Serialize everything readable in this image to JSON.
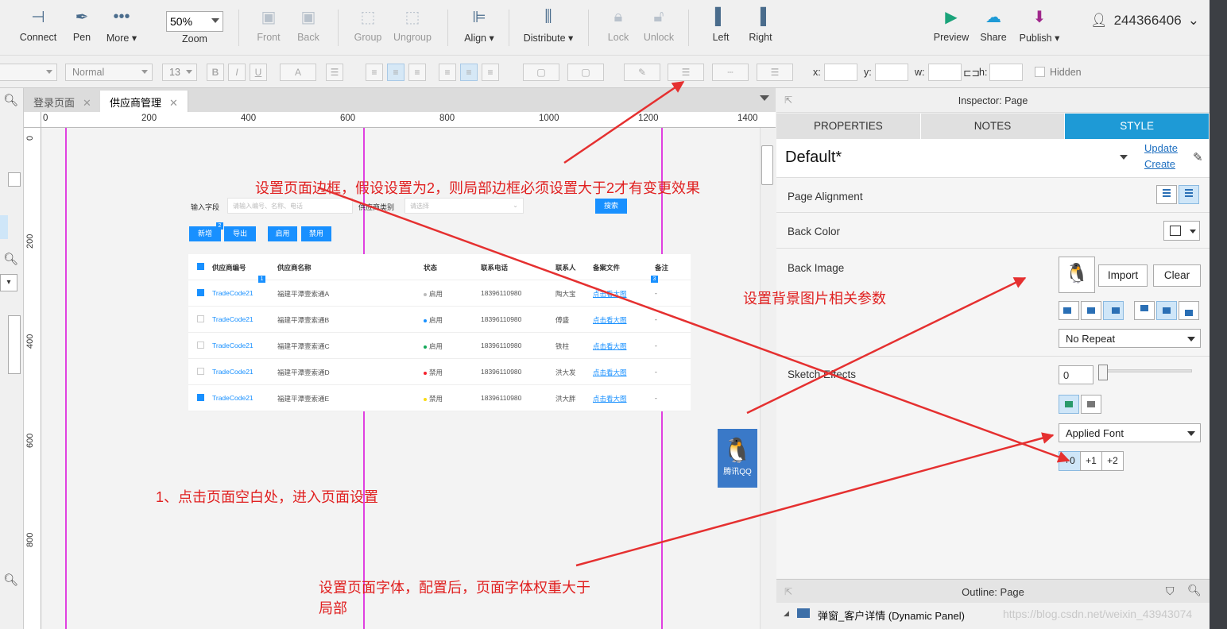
{
  "toolbar": {
    "items": [
      {
        "label": "Connect",
        "icon": "connect-icon"
      },
      {
        "label": "Pen",
        "icon": "pen-icon"
      },
      {
        "label": "More ▾",
        "icon": "more-icon"
      },
      {
        "label": "Zoom",
        "icon": "zoom"
      },
      {
        "label": "Front",
        "icon": "bring-front-icon"
      },
      {
        "label": "Back",
        "icon": "send-back-icon"
      },
      {
        "label": "Group",
        "icon": "group-icon"
      },
      {
        "label": "Ungroup",
        "icon": "ungroup-icon"
      },
      {
        "label": "Align ▾",
        "icon": "align-icon"
      },
      {
        "label": "Distribute ▾",
        "icon": "distribute-icon"
      },
      {
        "label": "Lock",
        "icon": "lock-icon"
      },
      {
        "label": "Unlock",
        "icon": "unlock-icon"
      },
      {
        "label": "Left",
        "icon": "left-panel-icon"
      },
      {
        "label": "Right",
        "icon": "right-panel-icon"
      },
      {
        "label": "Preview",
        "icon": "preview-icon"
      },
      {
        "label": "Share",
        "icon": "share-icon"
      },
      {
        "label": "Publish ▾",
        "icon": "publish-icon"
      }
    ],
    "zoom_value": "50%",
    "user": "244366406"
  },
  "format_bar": {
    "style_value": "Normal",
    "size_value": "13",
    "bold": "B",
    "italic": "I",
    "underline": "U",
    "font_color": "A",
    "x_label": "x:",
    "y_label": "y:",
    "w_label": "w:",
    "h_label": "h:",
    "hidden_label": "Hidden"
  },
  "tabs": [
    {
      "label": "登录页面",
      "active": false
    },
    {
      "label": "供应商管理",
      "active": true
    }
  ],
  "ruler": {
    "h": [
      "0",
      "200",
      "400",
      "600",
      "800",
      "1000",
      "1200",
      "1400"
    ],
    "v": [
      "0",
      "200",
      "400",
      "600",
      "800"
    ]
  },
  "proto": {
    "field1_label": "输入字段",
    "field1_placeholder": "请输入编号、名称、电话",
    "field2_label": "供应商类别",
    "field2_placeholder": "请选择",
    "search_btn": "搜索",
    "buttons": [
      "新增",
      "导出",
      "启用",
      "禁用"
    ],
    "badge_new": "2",
    "badge_1": "1",
    "badge_3": "3",
    "headers": [
      "供应商编号",
      "供应商名称",
      "状态",
      "联系电话",
      "联系人",
      "备案文件",
      "备注"
    ],
    "rows": [
      {
        "code": "TradeCode21",
        "name": "福建平潭壹索通A",
        "status": "启用",
        "status_color": "#bbbbbb",
        "phone": "18396110980",
        "contact": "陶大宝",
        "file": "点击看大图",
        "note": "-",
        "checked": true
      },
      {
        "code": "TradeCode21",
        "name": "福建平潭壹索通B",
        "status": "启用",
        "status_color": "#1890ff",
        "phone": "18396110980",
        "contact": "傅盛",
        "file": "点击看大图",
        "note": "-",
        "checked": false
      },
      {
        "code": "TradeCode21",
        "name": "福建平潭壹索通C",
        "status": "启用",
        "status_color": "#13a859",
        "phone": "18396110980",
        "contact": "铁柱",
        "file": "点击看大图",
        "note": "-",
        "checked": false
      },
      {
        "code": "TradeCode21",
        "name": "福建平潭壹索通D",
        "status": "禁用",
        "status_color": "#f5222d",
        "phone": "18396110980",
        "contact": "洪大发",
        "file": "点击看大图",
        "note": "-",
        "checked": false
      },
      {
        "code": "TradeCode21",
        "name": "福建平潭壹索通E",
        "status": "禁用",
        "status_color": "#fadb14",
        "phone": "18396110980",
        "contact": "洪大胖",
        "file": "点击看大图",
        "note": "-",
        "checked": true
      }
    ],
    "qq_label": "腾讯QQ"
  },
  "inspector": {
    "title": "Inspector: Page",
    "tabs": [
      {
        "label": "PROPERTIES"
      },
      {
        "label": "NOTES"
      },
      {
        "label": "STYLE",
        "active": true
      }
    ],
    "style_name": "Default*",
    "update_link": "Update",
    "create_link": "Create",
    "page_alignment": "Page Alignment",
    "back_color": "Back Color",
    "back_image": "Back Image",
    "import_btn": "Import",
    "clear_btn": "Clear",
    "repeat_value": "No Repeat",
    "sketch_label": "Sketch Effects",
    "sketch_value": "0",
    "font_value": "Applied Font",
    "font_size_btns": [
      "+0",
      "+1",
      "+2"
    ],
    "accent": "#1e9ad6"
  },
  "outline": {
    "title": "Outline: Page",
    "item": "弹窗_客户详情 (Dynamic Panel)"
  },
  "annotations": {
    "border": "设置页面边框，假设设置为2，则局部边框必须设置大于2才有变更效果",
    "bgimage": "设置背景图片相关参数",
    "click": "1、点击页面空白处，进入页面设置",
    "font_line1": "设置页面字体，配置后，页面字体权重大于",
    "font_line2": "局部",
    "color": "#e53030"
  },
  "watermark": "https://blog.csdn.net/weixin_43943074"
}
